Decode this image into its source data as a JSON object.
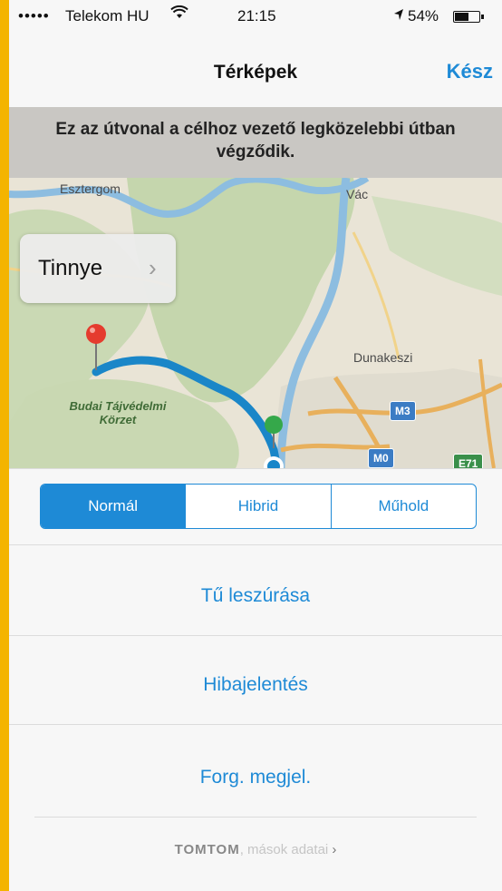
{
  "status_bar": {
    "signal": "•••••",
    "carrier": "Telekom HU",
    "wifi_icon": "wifi-icon",
    "time": "21:15",
    "location_icon": "location-arrow-icon",
    "battery_percent": "54%",
    "battery_level": 0.54
  },
  "navbar": {
    "title": "Térképek",
    "done_label": "Kész"
  },
  "banner": {
    "text": "Ez az útvonal a célhoz vezető legközelebbi útban végződik."
  },
  "map": {
    "callout_label": "Tinnye",
    "places": {
      "esztergom": "Esztergom",
      "vac": "Vác",
      "dunakeszi": "Dunakeszi"
    },
    "park": "Budai Tájvédelmi Körzet",
    "shields": {
      "m3": "M3",
      "m0": "M0",
      "e71": "E71"
    }
  },
  "map_type": {
    "options": [
      "Normál",
      "Hibrid",
      "Műhold"
    ],
    "selected": "Normál"
  },
  "actions": {
    "drop_pin": "Tű leszúrása",
    "report_problem": "Hibajelentés",
    "show_traffic": "Forg. megjel."
  },
  "footer": {
    "brand": "TOMTOM",
    "others_text": ", mások adatai",
    "chevron": "›"
  },
  "colors": {
    "accent": "#1e8ad6",
    "frame": "#f4b400",
    "route": "#1a86c8"
  }
}
